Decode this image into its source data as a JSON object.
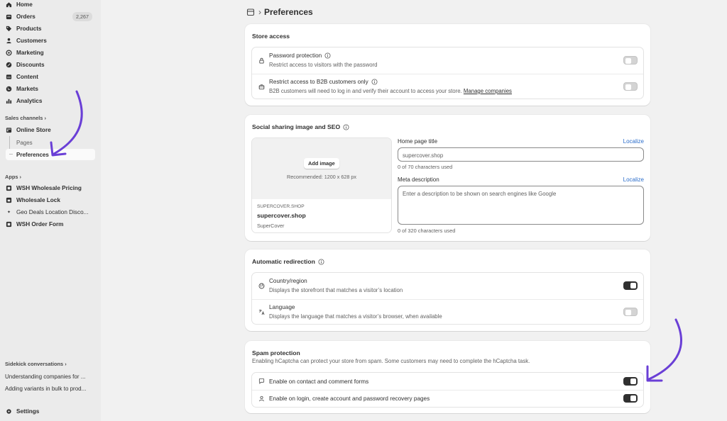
{
  "sidebar": {
    "nav": [
      {
        "label": "Home",
        "icon": "home-icon"
      },
      {
        "label": "Orders",
        "icon": "orders-icon",
        "badge": "2,267"
      },
      {
        "label": "Products",
        "icon": "tag-icon"
      },
      {
        "label": "Customers",
        "icon": "person-icon"
      },
      {
        "label": "Marketing",
        "icon": "target-icon"
      },
      {
        "label": "Discounts",
        "icon": "discount-icon"
      },
      {
        "label": "Content",
        "icon": "content-icon"
      },
      {
        "label": "Markets",
        "icon": "globe-icon"
      },
      {
        "label": "Analytics",
        "icon": "chart-icon"
      }
    ],
    "sales_channels_label": "Sales channels",
    "online_store": "Online Store",
    "pages": "Pages",
    "preferences": "Preferences",
    "apps_label": "Apps",
    "apps": [
      "WSH Wholesale Pricing",
      "Wholesale Lock",
      "Geo Deals Location Disco...",
      "WSH Order Form"
    ],
    "sidekick_label": "Sidekick conversations",
    "conversations": [
      "Understanding companies for ...",
      "Adding variants in bulk to prod..."
    ],
    "settings": "Settings"
  },
  "header": {
    "title": "Preferences"
  },
  "store_access": {
    "title": "Store access",
    "password_title": "Password protection",
    "password_desc": "Restrict access to visitors with the password",
    "b2b_title": "Restrict access to B2B customers only",
    "b2b_desc": "B2B customers will need to log in and verify their account to access your store.",
    "b2b_link": "Manage companies",
    "password_toggle": "off",
    "b2b_toggle": "off"
  },
  "seo": {
    "title": "Social sharing image and SEO",
    "add_image": "Add image",
    "recommended": "Recommended: 1200 x 628 px",
    "preview_domain": "SUPERCOVER.SHOP",
    "preview_title": "supercover.shop",
    "preview_sub": "SuperCover",
    "home_title_label": "Home page title",
    "localize": "Localize",
    "home_title_placeholder": "supercover.shop",
    "home_title_help": "0 of 70 characters used",
    "meta_label": "Meta description",
    "meta_placeholder": "Enter a description to be shown on search engines like Google",
    "meta_help": "0 of 320 characters used"
  },
  "redirection": {
    "title": "Automatic redirection",
    "country_title": "Country/region",
    "country_desc": "Displays the storefront that matches a visitor’s location",
    "country_toggle": "on",
    "language_title": "Language",
    "language_desc": "Displays the language that matches a visitor’s browser, when available",
    "language_toggle": "off"
  },
  "spam": {
    "title": "Spam protection",
    "desc": "Enabling hCaptcha can protect your store from spam. Some customers may need to complete the hCaptcha task.",
    "contact_label": "Enable on contact and comment forms",
    "contact_toggle": "on",
    "login_label": "Enable on login, create account and password recovery pages",
    "login_toggle": "on"
  },
  "colors": {
    "accent_arrow": "#6a3fd6",
    "link": "#2c6ecb",
    "toggle_on": "#303030",
    "toggle_off": "#d4d4d4"
  }
}
